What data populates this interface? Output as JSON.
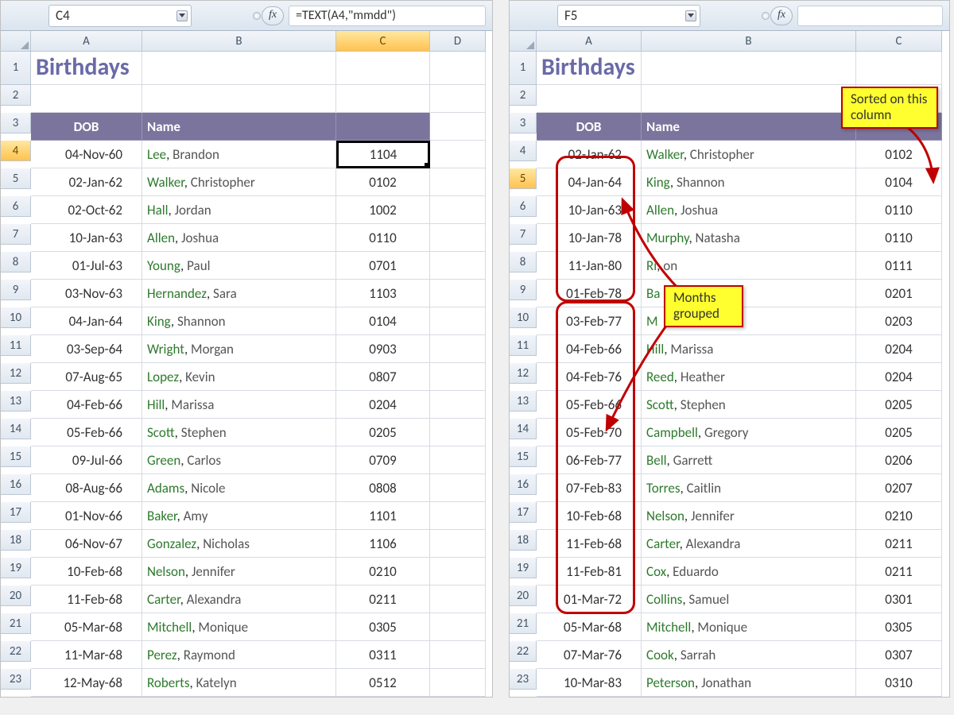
{
  "left": {
    "namebox": "C4",
    "formula": "=TEXT(A4,\"mmdd\")",
    "fx_label": "fx",
    "cols": [
      "A",
      "B",
      "C",
      "D"
    ],
    "active_col_idx": 2,
    "active_row": 4,
    "title": "Birthdays",
    "headers": {
      "dob": "DOB",
      "name": "Name"
    },
    "rows": [
      {
        "n": 4,
        "dob": "04-Nov-60",
        "name_last": "Lee",
        "name_first": "Brandon",
        "code": "1104",
        "selected": true
      },
      {
        "n": 5,
        "dob": "02-Jan-62",
        "name_last": "Walker",
        "name_first": "Christopher",
        "code": "0102"
      },
      {
        "n": 6,
        "dob": "02-Oct-62",
        "name_last": "Hall",
        "name_first": "Jordan",
        "code": "1002"
      },
      {
        "n": 7,
        "dob": "10-Jan-63",
        "name_last": "Allen",
        "name_first": "Joshua",
        "code": "0110"
      },
      {
        "n": 8,
        "dob": "01-Jul-63",
        "name_last": "Young",
        "name_first": "Paul",
        "code": "0701"
      },
      {
        "n": 9,
        "dob": "03-Nov-63",
        "name_last": "Hernandez",
        "name_first": "Sara",
        "code": "1103"
      },
      {
        "n": 10,
        "dob": "04-Jan-64",
        "name_last": "King",
        "name_first": "Shannon",
        "code": "0104"
      },
      {
        "n": 11,
        "dob": "03-Sep-64",
        "name_last": "Wright",
        "name_first": "Morgan",
        "code": "0903"
      },
      {
        "n": 12,
        "dob": "07-Aug-65",
        "name_last": "Lopez",
        "name_first": "Kevin",
        "code": "0807"
      },
      {
        "n": 13,
        "dob": "04-Feb-66",
        "name_last": "Hill",
        "name_first": "Marissa",
        "code": "0204"
      },
      {
        "n": 14,
        "dob": "05-Feb-66",
        "name_last": "Scott",
        "name_first": "Stephen",
        "code": "0205"
      },
      {
        "n": 15,
        "dob": "09-Jul-66",
        "name_last": "Green",
        "name_first": "Carlos",
        "code": "0709"
      },
      {
        "n": 16,
        "dob": "08-Aug-66",
        "name_last": "Adams",
        "name_first": "Nicole",
        "code": "0808"
      },
      {
        "n": 17,
        "dob": "01-Nov-66",
        "name_last": "Baker",
        "name_first": "Amy",
        "code": "1101"
      },
      {
        "n": 18,
        "dob": "06-Nov-67",
        "name_last": "Gonzalez",
        "name_first": "Nicholas",
        "code": "1106"
      },
      {
        "n": 19,
        "dob": "10-Feb-68",
        "name_last": "Nelson",
        "name_first": "Jennifer",
        "code": "0210"
      },
      {
        "n": 20,
        "dob": "11-Feb-68",
        "name_last": "Carter",
        "name_first": "Alexandra",
        "code": "0211"
      },
      {
        "n": 21,
        "dob": "05-Mar-68",
        "name_last": "Mitchell",
        "name_first": "Monique",
        "code": "0305"
      },
      {
        "n": 22,
        "dob": "11-Mar-68",
        "name_last": "Perez",
        "name_first": "Raymond",
        "code": "0311"
      },
      {
        "n": 23,
        "dob": "12-May-68",
        "name_last": "Roberts",
        "name_first": "Katelyn",
        "code": "0512"
      }
    ]
  },
  "right": {
    "namebox": "F5",
    "formula": "",
    "fx_label": "fx",
    "cols": [
      "A",
      "B",
      "C"
    ],
    "active_row": 5,
    "title": "Birthdays",
    "headers": {
      "dob": "DOB",
      "name": "Name"
    },
    "rows": [
      {
        "n": 4,
        "dob": "02-Jan-62",
        "name_last": "Walker",
        "name_first": "Christopher",
        "code": "0102"
      },
      {
        "n": 5,
        "dob": "04-Jan-64",
        "name_last": "King",
        "name_first": "Shannon",
        "code": "0104"
      },
      {
        "n": 6,
        "dob": "10-Jan-63",
        "name_last": "Allen",
        "name_first": "Joshua",
        "code": "0110"
      },
      {
        "n": 7,
        "dob": "10-Jan-78",
        "name_last": "Murphy",
        "name_first": "Natasha",
        "code": "0110"
      },
      {
        "n": 8,
        "dob": "11-Jan-80",
        "name_last": "Ri",
        "name_first": "on",
        "code": "0111"
      },
      {
        "n": 9,
        "dob": "01-Feb-78",
        "name_last": "Ba",
        "name_first": "",
        "code": "0201"
      },
      {
        "n": 10,
        "dob": "03-Feb-77",
        "name_last": "M",
        "name_first": "",
        "code": "0203"
      },
      {
        "n": 11,
        "dob": "04-Feb-66",
        "name_last": "Hill",
        "name_first": "Marissa",
        "code": "0204"
      },
      {
        "n": 12,
        "dob": "04-Feb-76",
        "name_last": "Reed",
        "name_first": "Heather",
        "code": "0204"
      },
      {
        "n": 13,
        "dob": "05-Feb-66",
        "name_last": "Scott",
        "name_first": "Stephen",
        "code": "0205"
      },
      {
        "n": 14,
        "dob": "05-Feb-70",
        "name_last": "Campbell",
        "name_first": "Gregory",
        "code": "0205"
      },
      {
        "n": 15,
        "dob": "06-Feb-77",
        "name_last": "Bell",
        "name_first": "Garrett",
        "code": "0206"
      },
      {
        "n": 16,
        "dob": "07-Feb-83",
        "name_last": "Torres",
        "name_first": "Caitlin",
        "code": "0207"
      },
      {
        "n": 17,
        "dob": "10-Feb-68",
        "name_last": "Nelson",
        "name_first": "Jennifer",
        "code": "0210"
      },
      {
        "n": 18,
        "dob": "11-Feb-68",
        "name_last": "Carter",
        "name_first": "Alexandra",
        "code": "0211"
      },
      {
        "n": 19,
        "dob": "11-Feb-81",
        "name_last": "Cox",
        "name_first": "Eduardo",
        "code": "0211"
      },
      {
        "n": 20,
        "dob": "01-Mar-72",
        "name_last": "Collins",
        "name_first": "Samuel",
        "code": "0301"
      },
      {
        "n": 21,
        "dob": "05-Mar-68",
        "name_last": "Mitchell",
        "name_first": "Monique",
        "code": "0305"
      },
      {
        "n": 22,
        "dob": "07-Mar-76",
        "name_last": "Cook",
        "name_first": "Sarrah",
        "code": "0307"
      },
      {
        "n": 23,
        "dob": "10-Mar-83",
        "name_last": "Peterson",
        "name_first": "Jonathan",
        "code": "0310"
      }
    ],
    "callouts": {
      "sorted": "Sorted on this column",
      "grouped": "Months grouped"
    }
  }
}
